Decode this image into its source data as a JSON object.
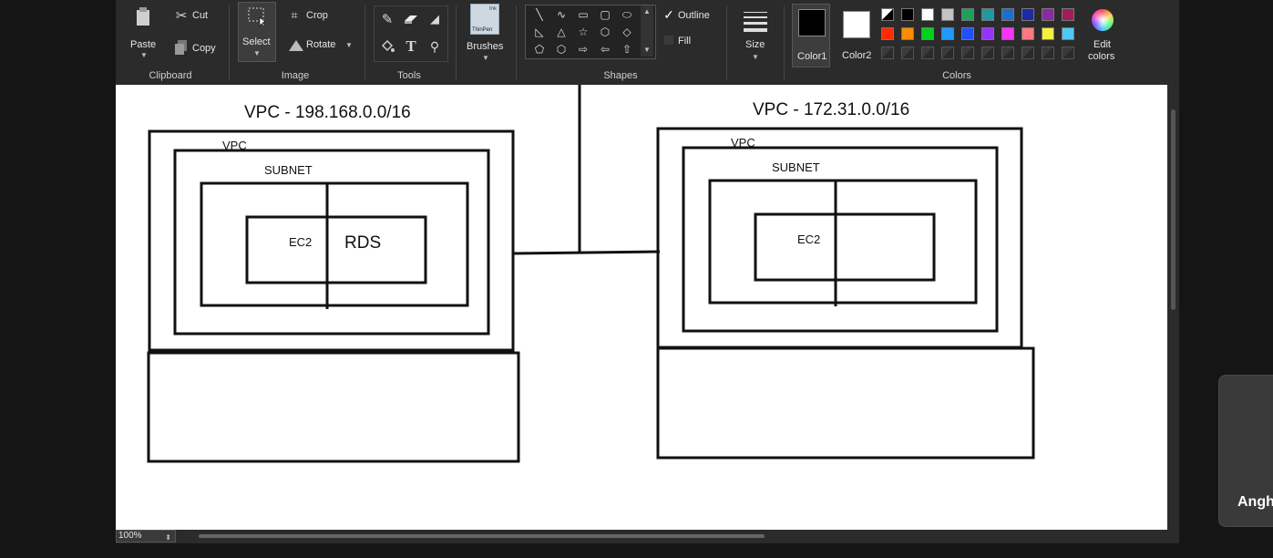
{
  "clipboard": {
    "paste_label": "Paste",
    "cut_label": "Cut",
    "copy_label": "Copy",
    "group_label": "Clipboard"
  },
  "image": {
    "select_label": "Select",
    "crop_label": "Crop",
    "rotate_label": "Rotate",
    "group_label": "Image"
  },
  "tools": {
    "group_label": "Tools",
    "icons": [
      "pencil-icon",
      "eraser-icon",
      "fill-icon",
      "fill-bucket-icon",
      "text-icon",
      "color-picker-icon"
    ]
  },
  "brushes": {
    "label": "Brushes",
    "thumb_label_1": "Ink",
    "thumb_label_2": "ThinPen"
  },
  "shapes": {
    "group_label": "Shapes",
    "outline_label": "Outline",
    "fill_label": "Fill",
    "glyphs": [
      "╲",
      "∿",
      "▭",
      "▢",
      "⬭",
      "◺",
      "△",
      "☆",
      "⬡",
      "◇",
      "⬠",
      "⬡",
      "⇨",
      "⇦",
      "⇧"
    ]
  },
  "size": {
    "label": "Size"
  },
  "colors": {
    "color1_label": "Color1",
    "color2_label": "Color2",
    "group_label": "Colors",
    "edit_label_1": "Edit",
    "edit_label_2": "colors",
    "color1": "#000000",
    "color2": "#ffffff",
    "row1": [
      "#000000",
      "#000000",
      "#ffffff",
      "#c3c3c3",
      "#1ea05a",
      "#1e9aa0",
      "#1e6ec8",
      "#1e2aa0",
      "#8c2aa0",
      "#a01e5a"
    ],
    "row2": [
      "#ff2a00",
      "#ff8c00",
      "#00d21e",
      "#1e9aff",
      "#1e50ff",
      "#9632ff",
      "#ff32ff",
      "#ff7882",
      "#f5f03c",
      "#50c8f5"
    ]
  },
  "drawing": {
    "vpc1_title": "VPC - 198.168.0.0/16",
    "vpc2_title": "VPC - 172.31.0.0/16",
    "vpc_label": "VPC",
    "subnet_label": "SUBNET",
    "ec2_label": "EC2",
    "rds_label": "RDS"
  },
  "status": {
    "zoom": "100%"
  },
  "notification": {
    "text": "Angh"
  }
}
